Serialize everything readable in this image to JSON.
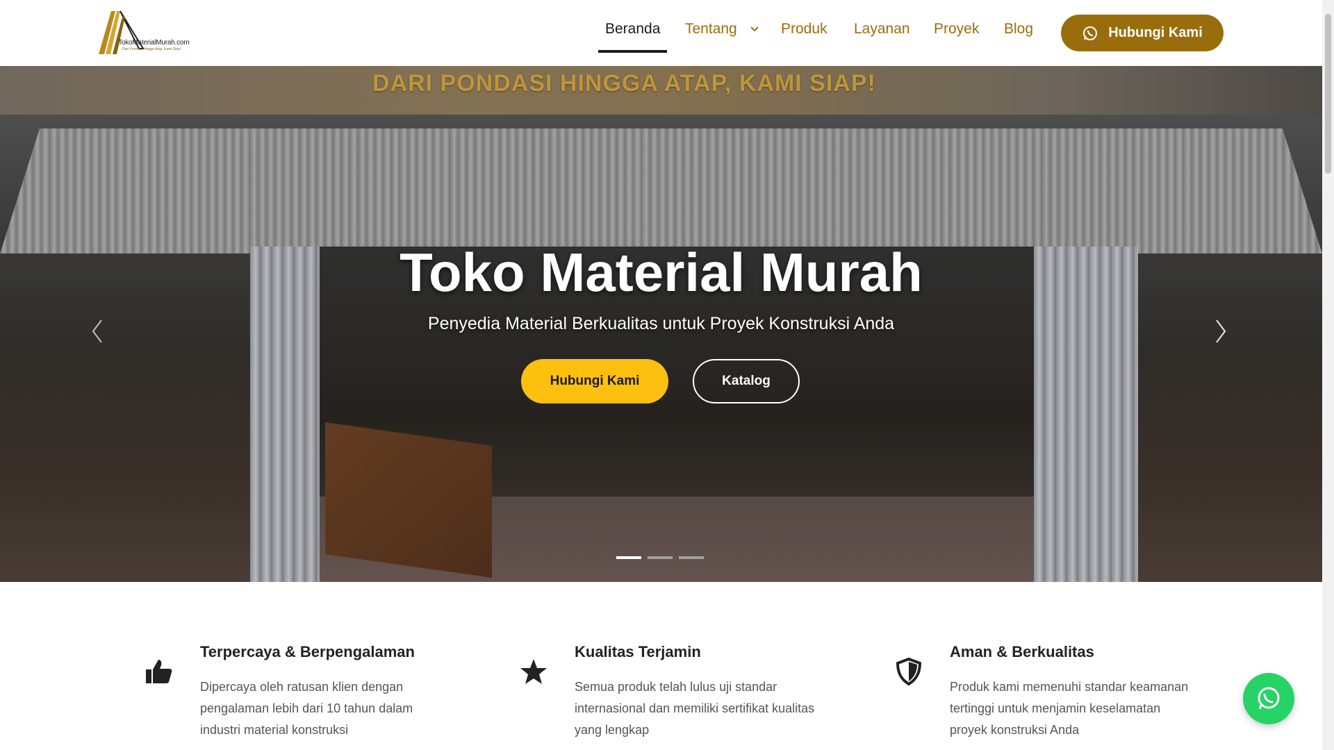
{
  "brand": {
    "logo_text": "TokoMaterialMurah.com",
    "logo_tagline": "Dari Pondasi Hingga Atap, Kami Siap!",
    "accent_color": "#9a6d0c",
    "yellow_color": "#fdc00f",
    "whatsapp_color": "#25d366"
  },
  "nav": {
    "items": [
      {
        "label": "Beranda",
        "active": true
      },
      {
        "label": "Tentang",
        "dropdown": true
      },
      {
        "label": "Produk"
      },
      {
        "label": "Layanan"
      },
      {
        "label": "Proyek"
      },
      {
        "label": "Blog"
      }
    ],
    "cta_label": "Hubungi Kami",
    "cta_icon": "whatsapp-icon"
  },
  "hero": {
    "banner_text": "DARI PONDASI HINGGA ATAP, KAMI SIAP!",
    "title": "Toko Material Murah",
    "subtitle": "Penyedia Material Berkualitas untuk Proyek Konstruksi Anda",
    "primary_button": "Hubungi Kami",
    "secondary_button": "Katalog",
    "slides_count": 3,
    "active_slide": 1
  },
  "features": [
    {
      "icon": "thumbs-up-icon",
      "title": "Terpercaya & Berpengalaman",
      "text": "Dipercaya oleh ratusan klien dengan pengalaman lebih dari 10 tahun dalam industri material konstruksi"
    },
    {
      "icon": "star-icon",
      "title": "Kualitas Terjamin",
      "text": "Semua produk telah lulus uji standar internasional dan memiliki sertifikat kualitas yang lengkap"
    },
    {
      "icon": "shield-icon",
      "title": "Aman & Berkualitas",
      "text": "Produk kami memenuhi standar keamanan tertinggi untuk menjamin keselamatan proyek konstruksi Anda"
    }
  ]
}
